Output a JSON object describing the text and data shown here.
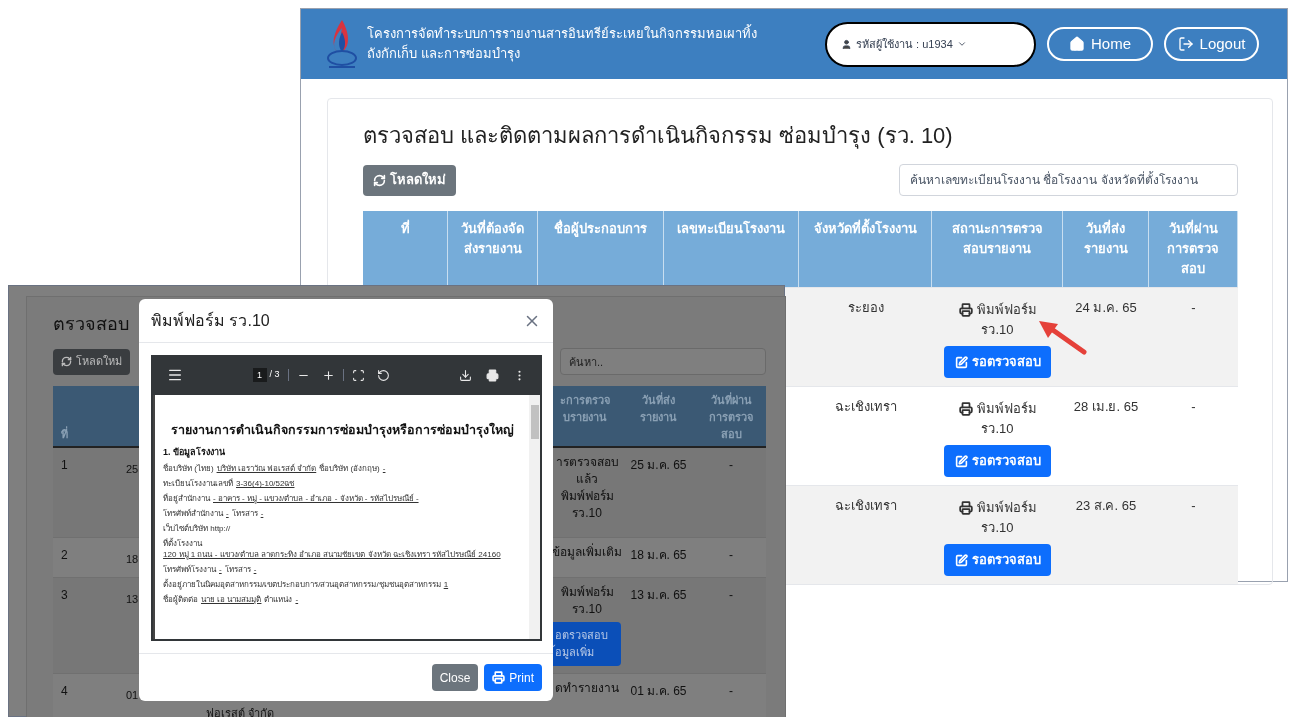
{
  "main_screen": {
    "navbar": {
      "title_lines": [
        "โครงการจัดทำระบบการรายงานสารอินทรีย์ระเหยในกิจกรรมหอเผาทิ้ง",
        "ถังกักเก็บ และการซ่อมบำรุง"
      ],
      "user_menu": "รหัสผู้ใช้งาน : u1934",
      "home_button": "Home",
      "logout_button": "Logout"
    },
    "page_title": "ตรวจสอบ และติดตามผลการดำเนินกิจกรรม ซ่อมบำรุง (รว. 10)",
    "reload_button": "โหลดใหม่",
    "search": {
      "placeholder": "ค้นหาเลขทะเบียนโรงงาน ชื่อโรงงาน จังหวัดที่ตั้งโรงงาน"
    },
    "table": {
      "columns": [
        [
          "ที่"
        ],
        [
          "วันที่ต้องจัด",
          "ส่งรายงาน"
        ],
        [
          "ชื่อผู้ประกอบการ"
        ],
        [
          "เลขทะเบียนโรงงาน"
        ],
        [
          "จังหวัดที่ตั้งโรงงาน"
        ],
        [
          "สถานะการตรวจ",
          "สอบรายงาน"
        ],
        [
          "วันที่ส่ง",
          "รายงาน"
        ],
        [
          "วันที่ผ่าน",
          "การตรวจ",
          "สอบ"
        ]
      ],
      "rows": [
        {
          "province": "ระยอง",
          "print_link": [
            "พิมพ์ฟอร์ม",
            "รว.10"
          ],
          "status_button": "รอตรวจสอบ",
          "sent_date": "24 ม.ค. 65",
          "passed_date": "-"
        },
        {
          "province": "ฉะเชิงเทรา",
          "print_link": [
            "พิมพ์ฟอร์ม",
            "รว.10"
          ],
          "status_button": "รอตรวจสอบ",
          "sent_date": "28 เม.ย. 65",
          "passed_date": "-"
        },
        {
          "province": "ฉะเชิงเทรา",
          "print_link": [
            "พิมพ์ฟอร์ม",
            "รว.10"
          ],
          "status_button": "รอตรวจสอบ",
          "sent_date": "23 ส.ค. 65",
          "passed_date": "-"
        }
      ]
    }
  },
  "popup_screen": {
    "page_title": "ตรวจสอบ",
    "reload_button": "โหลดใหม่",
    "search": {
      "placeholder": "ค้นหา.."
    },
    "table": {
      "header": {
        "number": [
          "ที่"
        ],
        "status": [
          "ะการตรวจ",
          "บรายงาน"
        ],
        "sent": [
          "วันที่ส่ง",
          "รายงาน"
        ],
        "passed": [
          "วันที่ผ่าน",
          "การตรวจ",
          "สอบ"
        ]
      },
      "rows": [
        {
          "number": "1",
          "column_2": "25",
          "status_lines": [
            "ารตรวจสอบ",
            "แล้ว",
            "พิมพ์ฟอร์ม",
            "รว.10"
          ],
          "sent_date": "25 ม.ค. 65",
          "passed_date": "-"
        },
        {
          "number": "2",
          "column_2": "18",
          "status_lines": [
            "ข้อมูลเพิ่มเติม"
          ],
          "sent_date": "18 ม.ค. 65",
          "passed_date": "-"
        },
        {
          "number": "3",
          "column_2": "13",
          "status_lines": [
            "พิมพ์ฟอร์ม",
            "รว.10"
          ],
          "status_button": [
            "อตรวจสอบ",
            "้อมูลเพิ่ม"
          ],
          "sent_date": "13 ม.ค. 65",
          "passed_date": "-"
        },
        {
          "number": "4",
          "column_2": "01",
          "column_3": "ฟอเรสต์ จำกัด",
          "status_lines": [
            "ดทำรายงาน"
          ],
          "sent_date": "01 ม.ค. 65",
          "passed_date": "-"
        }
      ]
    },
    "modal": {
      "title": "พิมพ์ฟอร์ม รว.10",
      "pdf_viewer": {
        "page": "1",
        "page_count": "/ 3",
        "document": {
          "title": "รายงานการดำเนินกิจกรรมการซ่อมบำรุงหรือการซ่อมบำรุงใหญ่",
          "heading": "1. ข้อมูลโรงงาน",
          "lines": [
            [
              {
                "text": "ชื่อบริษัท (ไทย)",
                "underline": false
              },
              {
                "text": "บริษัท เอราวัณ ฟอเรสต์ จำกัด",
                "underline": true
              },
              {
                "text": "ชื่อบริษัท (อังกฤษ)",
                "underline": false
              },
              {
                "text": "-",
                "underline": true
              }
            ],
            [
              {
                "text": "ทะเบียนโรงงานเลขที่",
                "underline": false
              },
              {
                "text": "3-36(4)-10/52ฉช",
                "underline": true
              }
            ],
            [
              {
                "text": "ที่อยู่สำนักงาน",
                "underline": false
              },
              {
                "text": "- อาคาร - หมู่ - แขวง/ตำบล - อำเภอ - จังหวัด - รหัสไปรษณีย์ -",
                "underline": true
              }
            ],
            [
              {
                "text": "โทรศัพท์สำนักงาน",
                "underline": false
              },
              {
                "text": "-",
                "underline": true
              },
              {
                "text": "โทรสาร",
                "underline": false
              },
              {
                "text": "-",
                "underline": true
              }
            ],
            [
              {
                "text": "เว็บไซต์บริษัท http://",
                "underline": false
              }
            ],
            [
              {
                "text": "ที่ตั้งโรงงาน",
                "underline": false
              },
              {
                "text": "120 หมู่ 1 ถนน - แขวง/ตำบล ลาดกระทิง อำเภอ สนามชัยเขต จังหวัด ฉะเชิงเทรา รหัสไปรษณีย์ 24160",
                "underline": true
              }
            ],
            [
              {
                "text": "โทรศัพท์โรงงาน",
                "underline": false
              },
              {
                "text": "-",
                "underline": true
              },
              {
                "text": "โทรสาร",
                "underline": false
              },
              {
                "text": "-",
                "underline": true
              }
            ],
            [
              {
                "text": "ตั้งอยู่ภายในนิคมอุตสาหกรรม/เขตประกอบการ/สวนอุตสาหกรรม/ชุมชนอุตสาหกรรม",
                "underline": false
              },
              {
                "text": "1",
                "underline": true
              }
            ],
            [
              {
                "text": "ชื่อผู้ติดต่อ",
                "underline": false
              },
              {
                "text": "นาย เอ นามสมมุติ",
                "underline": true
              },
              {
                "text": "ตำแหน่ง",
                "underline": false
              },
              {
                "text": "-",
                "underline": true
              }
            ]
          ]
        }
      },
      "close_button": "Close",
      "print_button": "Print"
    }
  }
}
